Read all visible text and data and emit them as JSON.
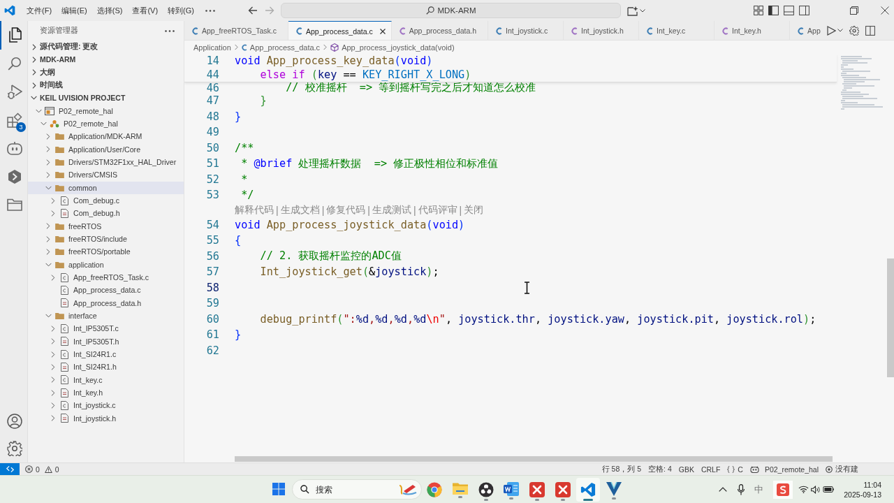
{
  "title_bar": {
    "menu": [
      "文件(F)",
      "编辑(E)",
      "选择(S)",
      "查看(V)",
      "转到(G)"
    ],
    "search": "MDK-ARM"
  },
  "activity_bar": {
    "items": [
      {
        "kind": "explorer",
        "selected": true
      },
      {
        "kind": "search",
        "selected": false
      },
      {
        "kind": "debug",
        "selected": false
      },
      {
        "kind": "extensions",
        "selected": false,
        "badge": "3"
      },
      {
        "kind": "robot",
        "selected": false
      },
      {
        "kind": "hexagon",
        "selected": false
      },
      {
        "kind": "folder",
        "selected": false
      }
    ],
    "bottom": [
      {
        "kind": "account"
      },
      {
        "kind": "settings"
      }
    ]
  },
  "sidebar": {
    "title": "资源管理器",
    "sections": [
      {
        "label": "源代码管理: 更改",
        "expanded": false
      },
      {
        "label": "MDK-ARM",
        "expanded": false
      },
      {
        "label": "大纲",
        "expanded": false
      },
      {
        "label": "时间线",
        "expanded": false
      },
      {
        "label": "KEIL UVISION PROJECT",
        "expanded": true,
        "tree": [
          {
            "label": "P02_remote_hal",
            "kind": "project",
            "expanded": true,
            "selected": false,
            "children": [
              {
                "label": "P02_remote_hal",
                "kind": "target",
                "expanded": true,
                "selected": false,
                "children": [
                  {
                    "label": "Application/MDK-ARM",
                    "kind": "folder",
                    "expanded": false,
                    "selected": false
                  },
                  {
                    "label": "Application/User/Core",
                    "kind": "folder",
                    "expanded": false,
                    "selected": false
                  },
                  {
                    "label": "Drivers/STM32F1xx_HAL_Driver",
                    "kind": "folder",
                    "expanded": false,
                    "selected": false
                  },
                  {
                    "label": "Drivers/CMSIS",
                    "kind": "folder",
                    "expanded": false,
                    "selected": false
                  },
                  {
                    "label": "common",
                    "kind": "folder",
                    "expanded": true,
                    "selected": true,
                    "children": [
                      {
                        "label": "Com_debug.c",
                        "kind": "c",
                        "expanded": false,
                        "selected": false
                      },
                      {
                        "label": "Com_debug.h",
                        "kind": "h",
                        "expanded": false,
                        "selected": false
                      }
                    ]
                  },
                  {
                    "label": "freeRTOS",
                    "kind": "folder",
                    "expanded": false,
                    "selected": false
                  },
                  {
                    "label": "freeRTOS/include",
                    "kind": "folder",
                    "expanded": false,
                    "selected": false
                  },
                  {
                    "label": "freeRTOS/portable",
                    "kind": "folder",
                    "expanded": false,
                    "selected": false
                  },
                  {
                    "label": "application",
                    "kind": "folder",
                    "expanded": true,
                    "selected": false,
                    "children": [
                      {
                        "label": "App_freeRTOS_Task.c",
                        "kind": "c",
                        "expanded": false,
                        "selected": false
                      },
                      {
                        "label": "App_process_data.c",
                        "kind": "c",
                        "selected": false
                      },
                      {
                        "label": "App_process_data.h",
                        "kind": "h",
                        "selected": false
                      }
                    ]
                  },
                  {
                    "label": "interface",
                    "kind": "folder",
                    "expanded": true,
                    "selected": false,
                    "children": [
                      {
                        "label": "Int_IP5305T.c",
                        "kind": "c",
                        "expanded": false,
                        "selected": false
                      },
                      {
                        "label": "Int_IP5305T.h",
                        "kind": "h",
                        "expanded": false,
                        "selected": false
                      },
                      {
                        "label": "Int_SI24R1.c",
                        "kind": "c",
                        "expanded": false,
                        "selected": false
                      },
                      {
                        "label": "Int_SI24R1.h",
                        "kind": "h",
                        "expanded": false,
                        "selected": false
                      },
                      {
                        "label": "Int_key.c",
                        "kind": "c",
                        "expanded": false,
                        "selected": false
                      },
                      {
                        "label": "Int_key.h",
                        "kind": "h",
                        "expanded": false,
                        "selected": false
                      },
                      {
                        "label": "Int_joystick.c",
                        "kind": "c",
                        "expanded": false,
                        "selected": false
                      },
                      {
                        "label": "Int_joystick.h",
                        "kind": "h",
                        "expanded": false,
                        "selected": false
                      }
                    ]
                  }
                ]
              }
            ]
          }
        ]
      }
    ]
  },
  "tabs": [
    {
      "label": "App_freeRTOS_Task.c",
      "kind": "c",
      "selected": false
    },
    {
      "label": "App_process_data.c",
      "kind": "c",
      "selected": true
    },
    {
      "label": "App_process_data.h",
      "kind": "h",
      "selected": false
    },
    {
      "label": "Int_joystick.c",
      "kind": "c",
      "selected": false
    },
    {
      "label": "Int_joystick.h",
      "kind": "h",
      "selected": false
    },
    {
      "label": "Int_key.c",
      "kind": "c",
      "selected": false
    },
    {
      "label": "Int_key.h",
      "kind": "h",
      "selected": false
    },
    {
      "label": "App",
      "kind": "c",
      "selected": false
    }
  ],
  "breadcrumb": [
    {
      "label": "Application",
      "kind": "folder"
    },
    {
      "label": "App_process_data.c",
      "kind": "c"
    },
    {
      "label": "App_process_joystick_data(void)",
      "kind": "function"
    }
  ],
  "editor": {
    "sticky_lines": [
      {
        "number": "14",
        "tokens": [
          {
            "text": "void",
            "kind": "keyword"
          },
          {
            "text": " App_process_key_data",
            "kind": "function"
          },
          {
            "text": "(",
            "kind": "bracket1"
          },
          {
            "text": "void",
            "kind": "keyword"
          },
          {
            "text": ")",
            "kind": "bracket1"
          }
        ]
      },
      {
        "number": "44",
        "tokens": [
          {
            "text": "    else if ",
            "kind": "control"
          },
          {
            "text": "(",
            "kind": "bracket2"
          },
          {
            "text": "key",
            "kind": "variable"
          },
          {
            "text": " == ",
            "kind": "plain"
          },
          {
            "text": "KEY_RIGHT_X_LONG",
            "kind": "macro"
          },
          {
            "text": ")",
            "kind": "bracket2"
          }
        ]
      }
    ],
    "lines": [
      {
        "kind": "code",
        "number": "46",
        "current": false,
        "tokens": [
          {
            "text": "        // 校准摇杆  => 等到摇杆写完之后才知道怎么校准",
            "kind": "comment"
          }
        ]
      },
      {
        "kind": "code",
        "number": "47",
        "current": false,
        "tokens": [
          {
            "text": "    }",
            "kind": "bracket2"
          }
        ]
      },
      {
        "kind": "code",
        "number": "48",
        "current": false,
        "tokens": [
          {
            "text": "}",
            "kind": "bracket1"
          }
        ]
      },
      {
        "kind": "code",
        "number": "49",
        "current": false
      },
      {
        "kind": "code",
        "number": "50",
        "current": false,
        "tokens": [
          {
            "text": "/**",
            "kind": "comment"
          }
        ]
      },
      {
        "kind": "code",
        "number": "51",
        "current": false,
        "tokens": [
          {
            "text": " * ",
            "kind": "comment"
          },
          {
            "text": "@brief",
            "kind": "doc"
          },
          {
            "text": " 处理摇杆数据  => 修正极性相位和标准值",
            "kind": "comment"
          }
        ]
      },
      {
        "kind": "code",
        "number": "52",
        "current": false,
        "tokens": [
          {
            "text": " *",
            "kind": "comment"
          }
        ]
      },
      {
        "kind": "code",
        "number": "53",
        "current": false,
        "tokens": [
          {
            "text": " */",
            "kind": "comment"
          }
        ]
      },
      {
        "kind": "codelens",
        "separator": "|",
        "actions": [
          "解释代码",
          "生成文档",
          "修复代码",
          "生成测试",
          "代码评审",
          "关闭"
        ]
      },
      {
        "kind": "code",
        "number": "54",
        "current": false,
        "tokens": [
          {
            "text": "void",
            "kind": "keyword"
          },
          {
            "text": " App_process_joystick_data",
            "kind": "function"
          },
          {
            "text": "(",
            "kind": "bracket1"
          },
          {
            "text": "void",
            "kind": "keyword"
          },
          {
            "text": ")",
            "kind": "bracket1"
          }
        ]
      },
      {
        "kind": "code",
        "number": "55",
        "current": false,
        "tokens": [
          {
            "text": "{",
            "kind": "bracket1"
          }
        ]
      },
      {
        "kind": "code",
        "number": "56",
        "current": false,
        "tokens": [
          {
            "text": "    // 2. 获取摇杆监控的ADC值",
            "kind": "comment"
          }
        ]
      },
      {
        "kind": "code",
        "number": "57",
        "current": false,
        "tokens": [
          {
            "text": "    Int_joystick_get",
            "kind": "function"
          },
          {
            "text": "(",
            "kind": "bracket2"
          },
          {
            "text": "&",
            "kind": "plain"
          },
          {
            "text": "joystick",
            "kind": "variable"
          },
          {
            "text": ")",
            "kind": "bracket2"
          },
          {
            "text": ";",
            "kind": "plain"
          }
        ]
      },
      {
        "kind": "code",
        "number": "58",
        "current": true
      },
      {
        "kind": "code",
        "number": "59",
        "current": false
      },
      {
        "kind": "code",
        "number": "60",
        "current": false,
        "tokens": [
          {
            "text": "    debug_printf",
            "kind": "function"
          },
          {
            "text": "(",
            "kind": "bracket2"
          },
          {
            "text": "\":",
            "kind": "string"
          },
          {
            "text": "%d",
            "kind": "format"
          },
          {
            "text": ",",
            "kind": "string"
          },
          {
            "text": "%d",
            "kind": "format"
          },
          {
            "text": ",",
            "kind": "string"
          },
          {
            "text": "%d",
            "kind": "format"
          },
          {
            "text": ",",
            "kind": "string"
          },
          {
            "text": "%d",
            "kind": "format"
          },
          {
            "text": "\\n",
            "kind": "escape"
          },
          {
            "text": "\"",
            "kind": "string"
          },
          {
            "text": ", ",
            "kind": "plain"
          },
          {
            "text": "joystick.thr",
            "kind": "variable"
          },
          {
            "text": ", ",
            "kind": "plain"
          },
          {
            "text": "joystick.yaw",
            "kind": "variable"
          },
          {
            "text": ", ",
            "kind": "plain"
          },
          {
            "text": "joystick.pit",
            "kind": "variable"
          },
          {
            "text": ", ",
            "kind": "plain"
          },
          {
            "text": "joystick.rol",
            "kind": "variable"
          },
          {
            "text": ")",
            "kind": "bracket2"
          },
          {
            "text": ";",
            "kind": "plain"
          }
        ]
      },
      {
        "kind": "code",
        "number": "61",
        "current": false,
        "tokens": [
          {
            "text": "}",
            "kind": "bracket1"
          }
        ]
      },
      {
        "kind": "code",
        "number": "62",
        "current": false
      }
    ]
  },
  "status_bar": {
    "errors": "0",
    "warnings": "0",
    "items": [
      {
        "kind": "plain",
        "text": "行 58，列 5"
      },
      {
        "kind": "plain",
        "text": "空格: 4"
      },
      {
        "kind": "plain",
        "text": "GBK"
      },
      {
        "kind": "plain",
        "text": "CRLF"
      },
      {
        "kind": "language",
        "text": "C"
      },
      {
        "kind": "project",
        "text": "P02_remote_hal"
      },
      {
        "kind": "notice",
        "text": "没有建"
      }
    ]
  },
  "taskbar": {
    "search": {
      "placeholder": "搜索"
    },
    "apps": [
      {
        "kind": "browser",
        "running": false,
        "selected": false
      },
      {
        "kind": "folder",
        "running": true,
        "selected": false
      },
      {
        "kind": "aperture",
        "running": true,
        "selected": false
      },
      {
        "kind": "document",
        "running": true,
        "selected": false
      },
      {
        "kind": "cross-app",
        "running": true,
        "selected": false
      },
      {
        "kind": "cross-app",
        "running": true,
        "selected": false
      },
      {
        "kind": "editor",
        "running": true,
        "selected": true
      },
      {
        "kind": "v-app",
        "running": true,
        "selected": false
      }
    ],
    "ime": "中",
    "time": "11:04",
    "date": "2025-09-13"
  }
}
